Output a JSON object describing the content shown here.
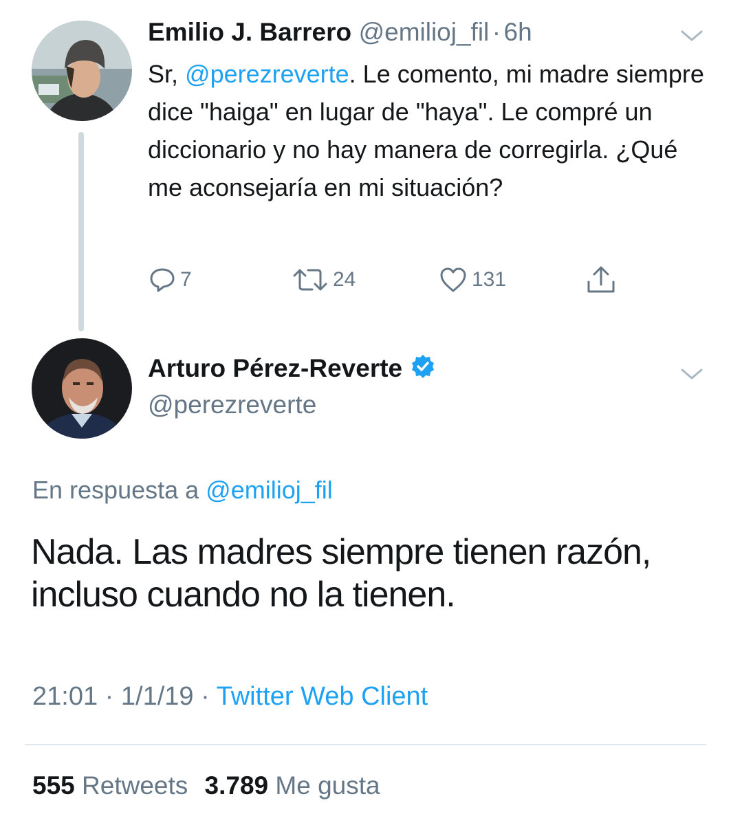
{
  "tweet1": {
    "name": "Emilio J. Barrero",
    "handle": "@emilioj_fil",
    "separator": "·",
    "time": "6h",
    "text_prefix": "Sr, ",
    "text_mention": "@perezreverte",
    "text_rest": ". Le comento, mi madre siempre dice \"haiga\" en lugar de \"haya\". Le compré un diccionario y no hay manera de corregirla. ¿Qué me aconsejaría en mi situación?",
    "replies": "7",
    "retweets": "24",
    "likes": "131",
    "icons": {
      "reply": "reply-icon",
      "retweet": "retweet-icon",
      "like": "heart-icon",
      "share": "share-icon",
      "menu": "chevron-down-icon"
    }
  },
  "tweet2": {
    "name": "Arturo Pérez-Reverte",
    "handle": "@perezreverte",
    "reply_label": "En respuesta a ",
    "reply_handle": "@emilioj_fil",
    "text": "Nada. Las madres siempre tienen razón, incluso cuando no la tienen.",
    "time": "21:01",
    "date": "1/1/19",
    "separator": "·",
    "client": "Twitter Web Client",
    "retweet_count": "555",
    "retweet_label": "Retweets",
    "like_count": "3.789",
    "like_label": "Me gusta",
    "icons": {
      "verified": "verified-badge-icon",
      "menu": "chevron-down-icon"
    }
  },
  "colors": {
    "accent": "#1da1f2",
    "muted": "#657786",
    "text": "#14171a",
    "thread": "#cfd9de",
    "divider": "#e1e8ed"
  }
}
